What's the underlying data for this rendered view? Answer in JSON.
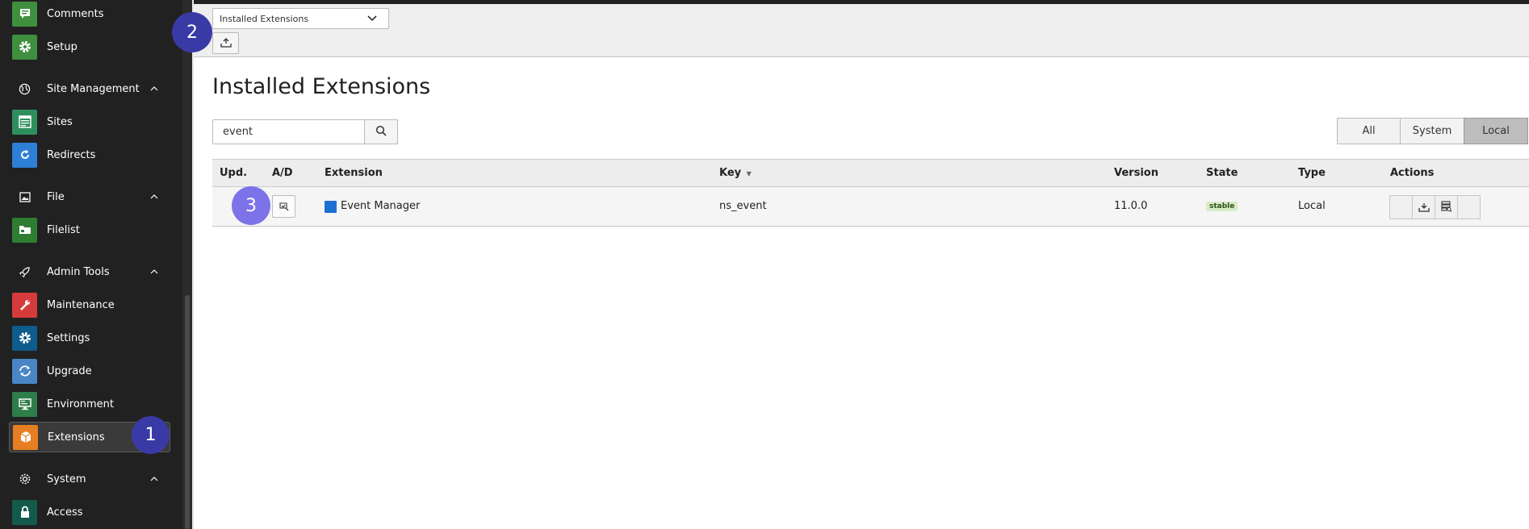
{
  "sidebar": {
    "items": {
      "comments": {
        "label": "Comments",
        "color": "#3f8f3f"
      },
      "setup": {
        "label": "Setup",
        "color": "#3f8f3f"
      },
      "site_management": {
        "label": "Site Management"
      },
      "sites": {
        "label": "Sites",
        "color": "#2e8f5e"
      },
      "redirects": {
        "label": "Redirects",
        "color": "#2d7fd8"
      },
      "file": {
        "label": "File"
      },
      "filelist": {
        "label": "Filelist",
        "color": "#2f7d32"
      },
      "admin_tools": {
        "label": "Admin Tools"
      },
      "maintenance": {
        "label": "Maintenance",
        "color": "#d63b3b"
      },
      "settings": {
        "label": "Settings",
        "color": "#0d5c8d"
      },
      "upgrade": {
        "label": "Upgrade",
        "color": "#4a86c5"
      },
      "environment": {
        "label": "Environment",
        "color": "#2e7d4a"
      },
      "extensions": {
        "label": "Extensions",
        "color": "#e67e22"
      },
      "system": {
        "label": "System"
      },
      "access": {
        "label": "Access",
        "color": "#145a4c"
      }
    }
  },
  "docheader": {
    "select_value": "Installed Extensions"
  },
  "main": {
    "title": "Installed Extensions",
    "search_value": "event",
    "filters": [
      "All",
      "System",
      "Local"
    ],
    "active_filter": "Local"
  },
  "table": {
    "headers": {
      "upd": "Upd.",
      "ad": "A/D",
      "extension": "Extension",
      "key": "Key",
      "version": "Version",
      "state": "State",
      "type": "Type",
      "actions": "Actions"
    },
    "rows": [
      {
        "extension": "Event Manager",
        "key": "ns_event",
        "version": "11.0.0",
        "state": "stable",
        "type": "Local"
      }
    ]
  },
  "steps": [
    "1",
    "2",
    "3"
  ]
}
